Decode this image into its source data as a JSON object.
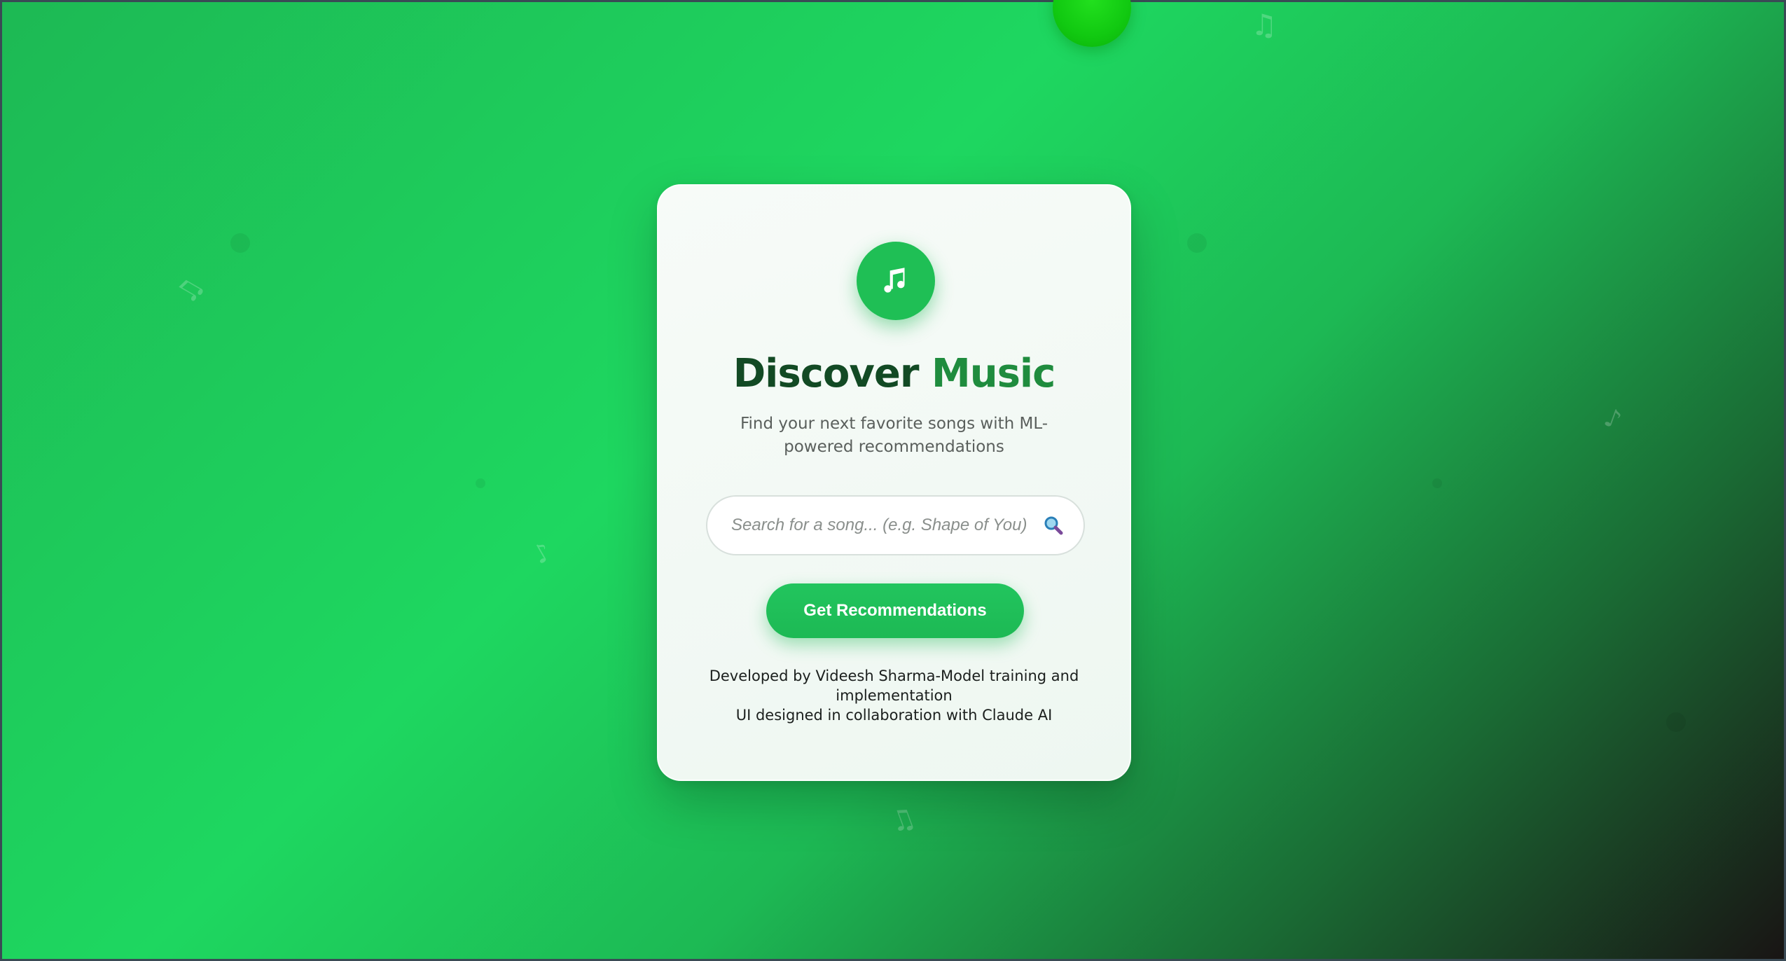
{
  "app": {
    "title": "Discover",
    "title_accent": "Music",
    "subtitle": "Find your next favorite songs with ML-powered recommendations",
    "logo_icon": "music-note-icon"
  },
  "search": {
    "placeholder": "Search for a song... (e.g. Shape of You)",
    "value": "",
    "icon": "magnifier-icon"
  },
  "actions": {
    "recommend_label": "Get Recommendations"
  },
  "footer": {
    "line1": "Developed by Videesh Sharma-Model training and implementation",
    "line2": "UI designed in collaboration with Claude AI"
  },
  "colors": {
    "accent": "#1db954",
    "accent_light": "#1ed760",
    "dark": "#191414",
    "title_dark": "#124a24",
    "title_accent": "#1f8c3e"
  }
}
